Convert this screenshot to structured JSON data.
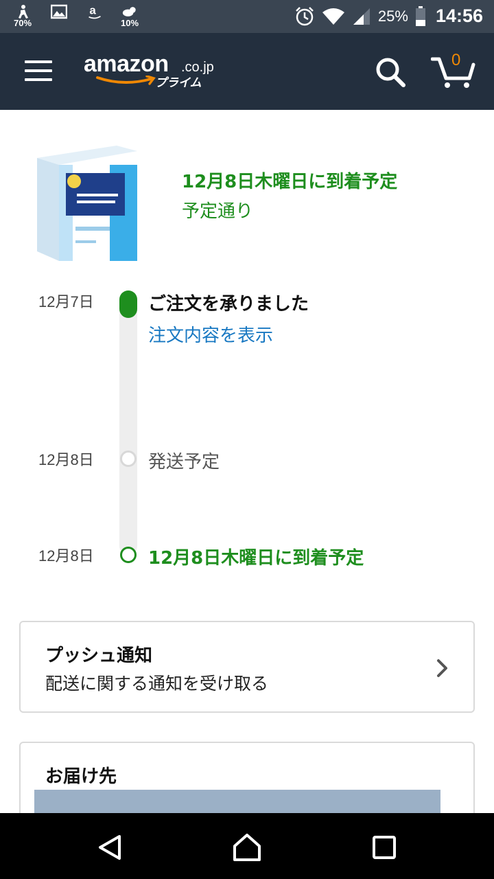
{
  "status_bar": {
    "left_items": [
      {
        "icon": "notification-person-icon",
        "pct": "70%"
      },
      {
        "icon": "image-icon",
        "pct": ""
      },
      {
        "icon": "amazon-a-icon",
        "pct": ""
      },
      {
        "icon": "weather-icon",
        "pct": "10%"
      }
    ],
    "right": {
      "alarm_icon": "alarm-icon",
      "wifi_icon": "wifi-icon",
      "signal_icon": "signal-icon",
      "battery_text": "25%",
      "battery_icon": "battery-icon",
      "time": "14:56"
    }
  },
  "header": {
    "brand": "amazon",
    "brand_tld": ".co.jp",
    "brand_sub": "プライム",
    "cart_count": "0",
    "accent_color": "#f08804",
    "bar_color": "#232f3e"
  },
  "order": {
    "product_image": "tissue-box",
    "delivery_title": "12月8日木曜日に到着予定",
    "delivery_status": "予定通り",
    "timeline": [
      {
        "date": "12月7日",
        "label": "ご注文を承りました",
        "link": "注文内容を表示",
        "state": "done"
      },
      {
        "date": "12月8日",
        "label": "発送予定",
        "state": "pending"
      },
      {
        "date": "12月8日",
        "label": "12月8日木曜日に到着予定",
        "state": "expected"
      }
    ],
    "status_color": "#1e8e1e",
    "link_color": "#1878c2"
  },
  "push_card": {
    "title": "プッシュ通知",
    "subtitle": "配送に関する通知を受け取る"
  },
  "address_card": {
    "title": "お届け先"
  },
  "nav": {
    "back_icon": "back-icon",
    "home_icon": "home-icon",
    "recent_icon": "recent-apps-icon"
  }
}
